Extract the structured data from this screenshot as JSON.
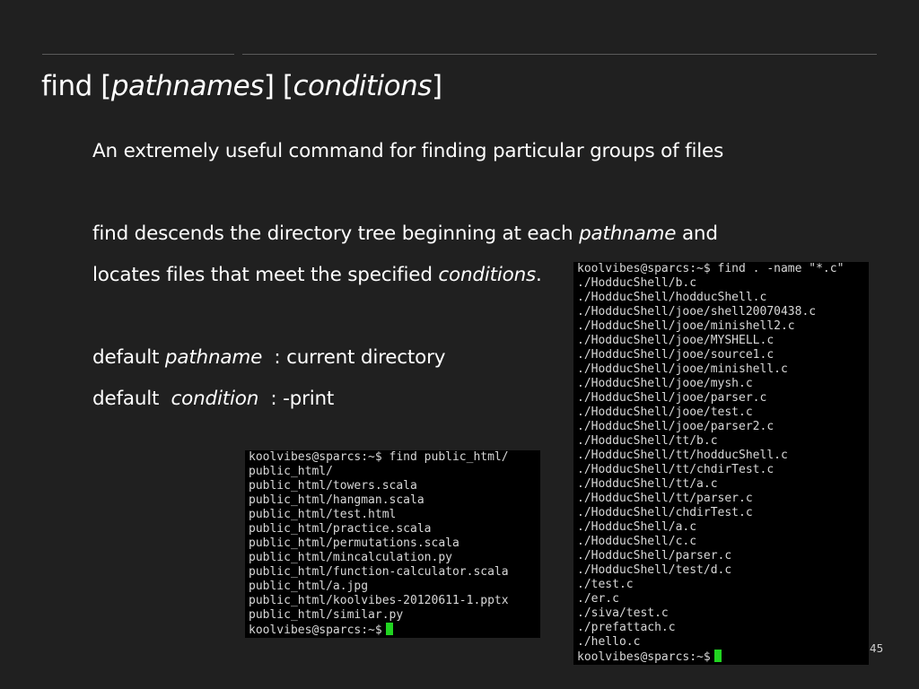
{
  "title": {
    "cmd": "find ",
    "br1_open": "[",
    "arg1": "pathnames",
    "br1_close": "]",
    "gap": " ",
    "br2_open": "[",
    "arg2": "conditions",
    "br2_close": "]"
  },
  "body": {
    "line1": "An extremely useful command for finding particular groups of files",
    "line2_a": "find descends the directory tree beginning at each ",
    "line2_em": "pathname",
    "line2_b": " and",
    "line3_a": "locates files that meet the specified ",
    "line3_em": "conditions",
    "line3_b": ".",
    "line4_a": "default ",
    "line4_em": "pathname",
    "line4_b": "  : current directory",
    "line5_a": "default  ",
    "line5_em": "condition",
    "line5_b": "  : -print"
  },
  "terminal_left": {
    "lines": [
      "koolvibes@sparcs:~$ find public_html/",
      "public_html/",
      "public_html/towers.scala",
      "public_html/hangman.scala",
      "public_html/test.html",
      "public_html/practice.scala",
      "public_html/permutations.scala",
      "public_html/mincalculation.py",
      "public_html/function-calculator.scala",
      "public_html/a.jpg",
      "public_html/koolvibes-20120611-1.pptx",
      "public_html/similar.py"
    ],
    "prompt": "koolvibes@sparcs:~$"
  },
  "terminal_right": {
    "lines": [
      "koolvibes@sparcs:~$ find . -name \"*.c\"",
      "./HodducShell/b.c",
      "./HodducShell/hodducShell.c",
      "./HodducShell/jooe/shell20070438.c",
      "./HodducShell/jooe/minishell2.c",
      "./HodducShell/jooe/MYSHELL.c",
      "./HodducShell/jooe/source1.c",
      "./HodducShell/jooe/minishell.c",
      "./HodducShell/jooe/mysh.c",
      "./HodducShell/jooe/parser.c",
      "./HodducShell/jooe/test.c",
      "./HodducShell/jooe/parser2.c",
      "./HodducShell/tt/b.c",
      "./HodducShell/tt/hodducShell.c",
      "./HodducShell/tt/chdirTest.c",
      "./HodducShell/tt/a.c",
      "./HodducShell/tt/parser.c",
      "./HodducShell/chdirTest.c",
      "./HodducShell/a.c",
      "./HodducShell/c.c",
      "./HodducShell/parser.c",
      "./HodducShell/test/d.c",
      "./test.c",
      "./er.c",
      "./siva/test.c",
      "./prefattach.c",
      "./hello.c"
    ],
    "prompt": "koolvibes@sparcs:~$"
  },
  "page_number": "45",
  "colors": {
    "background": "#202020",
    "terminal_bg": "#000000",
    "cursor": "#21d421"
  }
}
